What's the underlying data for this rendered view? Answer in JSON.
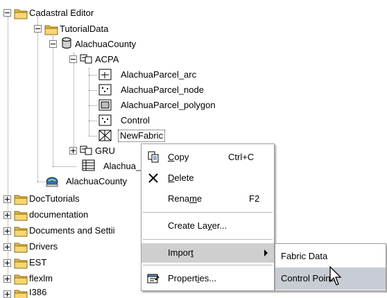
{
  "tree": {
    "cadastral_editor": "Cadastral Editor",
    "tutorial_data": "TutorialData",
    "alachua_county_db": "AlachuaCounty",
    "acpa": "ACPA",
    "parcel_arc": "AlachuaParcel_arc",
    "parcel_node": "AlachuaParcel_node",
    "parcel_polygon": "AlachuaParcel_polygon",
    "control": "Control",
    "new_fabric": "NewFabric",
    "gru": "GRU",
    "alachua_truncated": "Alachua_",
    "alachua_county_layer": "AlachuaCounty",
    "doc_tutorials": "DocTutorials",
    "documentation": "documentation",
    "documents_settings": "Documents and Settii",
    "drivers": "Drivers",
    "est": "EST",
    "flexlm": "flexlm",
    "i386": "I386"
  },
  "context_menu": {
    "copy": {
      "pre": "",
      "u": "C",
      "post": "opy",
      "shortcut": "Ctrl+C"
    },
    "delete": {
      "pre": "",
      "u": "D",
      "post": "elete"
    },
    "rename": {
      "pre": "Rena",
      "u": "m",
      "post": "e",
      "shortcut": "F2"
    },
    "create_layer": {
      "pre": "Create La",
      "u": "y",
      "post": "er..."
    },
    "import": {
      "pre": "Impor",
      "u": "t",
      "post": ""
    },
    "properties": {
      "pre": "Propert",
      "u": "i",
      "post": "es..."
    }
  },
  "submenu": {
    "fabric_data": "Fabric Data",
    "control_points": "Control Points"
  },
  "colors": {
    "folder": "#f2c94c",
    "menu_highlight": "#cfcfcf",
    "submenu_highlight": "#c8ccd4"
  }
}
